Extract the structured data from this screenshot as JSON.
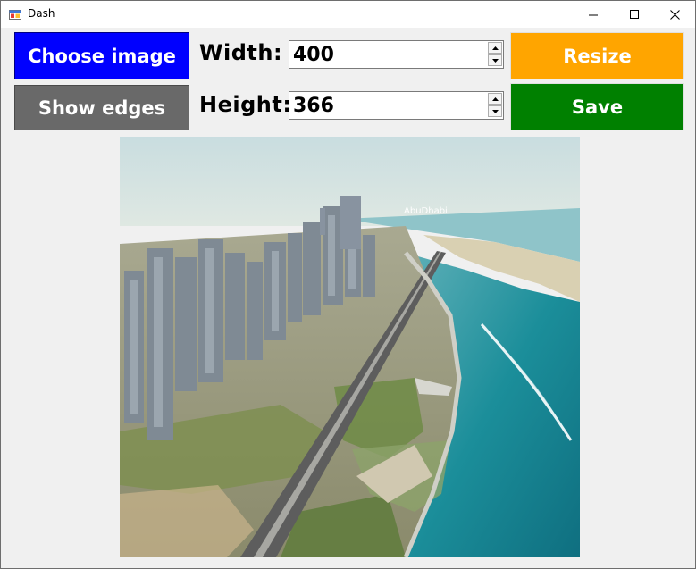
{
  "window": {
    "title": "Dash"
  },
  "controls": {
    "choose_image_label": "Choose image",
    "show_edges_label": "Show edges",
    "resize_label": "Resize",
    "save_label": "Save",
    "width_label": "Width:",
    "height_label": "Height:",
    "width_value": "400",
    "height_value": "366"
  },
  "image": {
    "watermark": "AbuDhabi"
  },
  "colors": {
    "choose_image": "#0000ff",
    "show_edges": "#696969",
    "resize": "#ffa500",
    "save": "#008000"
  }
}
